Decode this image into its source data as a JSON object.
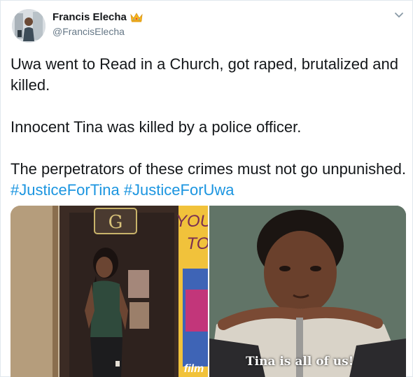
{
  "author": {
    "display_name": "Francis Elecha",
    "handle": "@FrancisElecha",
    "badge_icon": "crown-emoji-icon"
  },
  "tweet": {
    "paragraph_1": "Uwa went to Read in a Church, got raped, brutalized and killed.",
    "paragraph_2": "Innocent Tina was killed by a police officer.",
    "paragraph_3_text": "The perpetrators of these crimes must not go unpunished. ",
    "hashtag_1": "#JusticeForTina",
    "hashtag_2": "#JusticeForUwa"
  },
  "media": {
    "left_photo_sign_text": "YOU TO",
    "left_photo_logo_letter": "G",
    "left_photo_film_text": "film",
    "right_photo_caption": "Tina is all of us!"
  },
  "colors": {
    "hashtag": "#1b95e0",
    "handle": "#657786",
    "text": "#14171a"
  }
}
